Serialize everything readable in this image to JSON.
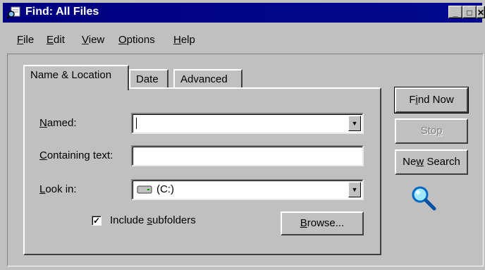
{
  "window": {
    "title": "Find: All Files",
    "controls": {
      "minimize": "_",
      "maximize": "□",
      "close": "✕"
    }
  },
  "menu": [
    {
      "key": "F",
      "rest": "ile"
    },
    {
      "key": "E",
      "rest": "dit"
    },
    {
      "key": "V",
      "rest": "iew"
    },
    {
      "key": "O",
      "rest": "ptions"
    },
    {
      "key": "H",
      "rest": "elp"
    }
  ],
  "tabs": [
    {
      "label": "Name & Location",
      "active": true
    },
    {
      "label": "Date",
      "active": false
    },
    {
      "label": "Advanced",
      "active": false
    }
  ],
  "form": {
    "named": {
      "pre": "",
      "key": "N",
      "post": "amed:",
      "value": ""
    },
    "containing": {
      "pre": "",
      "key": "C",
      "post": "ontaining text:",
      "value": ""
    },
    "look_in": {
      "pre": "",
      "key": "L",
      "post": "ook in:",
      "value": "(C:)",
      "icon": "drive-icon"
    },
    "subfolders": {
      "pre": "Include ",
      "key": "s",
      "post": "ubfolders",
      "checked": true
    }
  },
  "buttons": {
    "browse": {
      "pre": "",
      "key": "B",
      "post": "rowse..."
    },
    "find_now": {
      "pre": "F",
      "key": "i",
      "post": "nd Now"
    },
    "stop": {
      "pre": "Sto",
      "key": "p",
      "post": ""
    },
    "new_search": {
      "pre": "Ne",
      "key": "w",
      "post": " Search"
    }
  },
  "icons": {
    "app": "find-files-icon",
    "magnifier": "magnifying-glass-icon"
  }
}
